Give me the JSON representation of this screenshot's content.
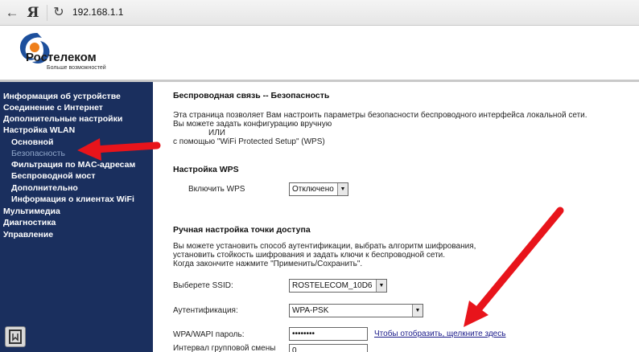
{
  "browser": {
    "back_glyph": "←",
    "ya_glyph": "Я",
    "reload_glyph": "↻",
    "address": "192.168.1.1"
  },
  "brand": {
    "name": "Ростелеком",
    "tagline": "Больше возможностей",
    "colors": {
      "blue": "#1d4f9c",
      "orange": "#ef7f1a",
      "sidebar": "#1a2f5e"
    }
  },
  "sidebar": {
    "items": [
      {
        "label": "Информация об устройстве",
        "level": 1
      },
      {
        "label": "Соединение с Интернет",
        "level": 1
      },
      {
        "label": "Дополнительные настройки",
        "level": 1
      },
      {
        "label": "Настройка WLAN",
        "level": 1
      },
      {
        "label": "Основной",
        "level": 2
      },
      {
        "label": "Безопасность",
        "level": 2,
        "active": true
      },
      {
        "label": "Фильтрация по MAC-адресам",
        "level": 2
      },
      {
        "label": "Беспроводной мост",
        "level": 2
      },
      {
        "label": "Дополнительно",
        "level": 2
      },
      {
        "label": "Информация о клиентах WiFi",
        "level": 2
      },
      {
        "label": "Мультимедиа",
        "level": 1
      },
      {
        "label": "Диагностика",
        "level": 1
      },
      {
        "label": "Управление",
        "level": 1
      }
    ]
  },
  "main": {
    "title": "Беспроводная связь -- Безопасность",
    "intro": [
      "Эта страница позволяет Вам настроить параметры безопасности беспроводного интерфейса локальной сети.",
      "Вы можете задать конфигурацию вручную",
      "ИЛИ",
      "с помощью \"WiFi Protected Setup\" (WPS)"
    ],
    "wps": {
      "title": "Настройка WPS",
      "enable_label": "Включить WPS",
      "enable_value": "Отключено"
    },
    "manual": {
      "title": "Ручная настройка точки доступа",
      "desc": [
        "Вы можете установить способ аутентификации, выбрать алгоритм шифрования,",
        "установить стойкость шифрования и задать ключи к беспроводной сети.",
        "Когда закончите нажмите \"Применить/Сохранить\"."
      ],
      "ssid_label": "Выберете SSID:",
      "ssid_value": "ROSTELECOM_10D6",
      "auth_label": "Аутентификация:",
      "auth_value": "WPA-PSK",
      "password_label": "WPA/WAPI пароль:",
      "password_value": "••••••••",
      "show_password_link": "Чтобы отобразить, щелкните здесь",
      "group_interval_label": "Интервал групповой смены",
      "group_interval_value": "0"
    }
  },
  "annotations": {
    "arrow_color": "#e8141b"
  }
}
